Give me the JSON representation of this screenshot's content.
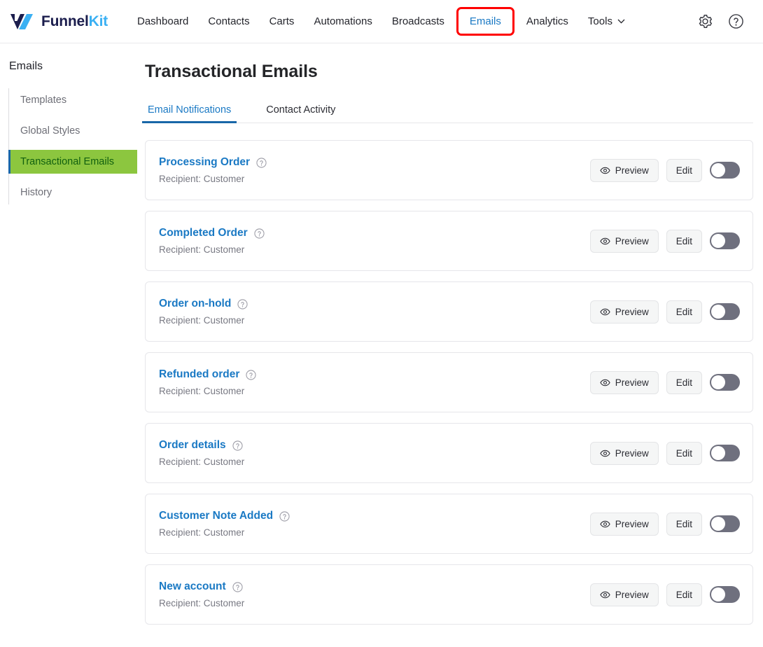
{
  "brand": {
    "name_part1": "Funnel",
    "name_part2": "Kit",
    "color_dark": "#1b1d4d",
    "color_light": "#3ab0f3"
  },
  "topnav": {
    "items": [
      {
        "label": "Dashboard",
        "active": false,
        "highlighted": false,
        "has_caret": false
      },
      {
        "label": "Contacts",
        "active": false,
        "highlighted": false,
        "has_caret": false
      },
      {
        "label": "Carts",
        "active": false,
        "highlighted": false,
        "has_caret": false
      },
      {
        "label": "Automations",
        "active": false,
        "highlighted": false,
        "has_caret": false
      },
      {
        "label": "Broadcasts",
        "active": false,
        "highlighted": false,
        "has_caret": false
      },
      {
        "label": "Emails",
        "active": true,
        "highlighted": true,
        "has_caret": false
      },
      {
        "label": "Analytics",
        "active": false,
        "highlighted": false,
        "has_caret": false
      },
      {
        "label": "Tools",
        "active": false,
        "highlighted": false,
        "has_caret": true
      }
    ],
    "highlight_color": "#ff0000",
    "active_color": "#1a79c4",
    "icons": [
      {
        "name": "settings-gear-icon"
      },
      {
        "name": "help-circle-icon"
      }
    ]
  },
  "sidebar": {
    "title": "Emails",
    "active_bg": "#8cc63f",
    "active_marker": "#1967a8",
    "items": [
      {
        "label": "Templates",
        "active": false
      },
      {
        "label": "Global Styles",
        "active": false
      },
      {
        "label": "Transactional Emails",
        "active": true
      },
      {
        "label": "History",
        "active": false
      }
    ]
  },
  "main": {
    "page_title": "Transactional Emails",
    "tabs": [
      {
        "label": "Email Notifications",
        "active": true
      },
      {
        "label": "Contact Activity",
        "active": false
      }
    ],
    "tab_accent": "#1967a8",
    "buttons": {
      "preview_label": "Preview",
      "edit_label": "Edit"
    },
    "emails": [
      {
        "title": "Processing Order",
        "recipient": "Recipient: Customer",
        "enabled": false
      },
      {
        "title": "Completed Order",
        "recipient": "Recipient: Customer",
        "enabled": false
      },
      {
        "title": "Order on-hold",
        "recipient": "Recipient: Customer",
        "enabled": false
      },
      {
        "title": "Refunded order",
        "recipient": "Recipient: Customer",
        "enabled": false
      },
      {
        "title": "Order details",
        "recipient": "Recipient: Customer",
        "enabled": false
      },
      {
        "title": "Customer Note Added",
        "recipient": "Recipient: Customer",
        "enabled": false
      },
      {
        "title": "New account",
        "recipient": "Recipient: Customer",
        "enabled": false
      }
    ]
  }
}
